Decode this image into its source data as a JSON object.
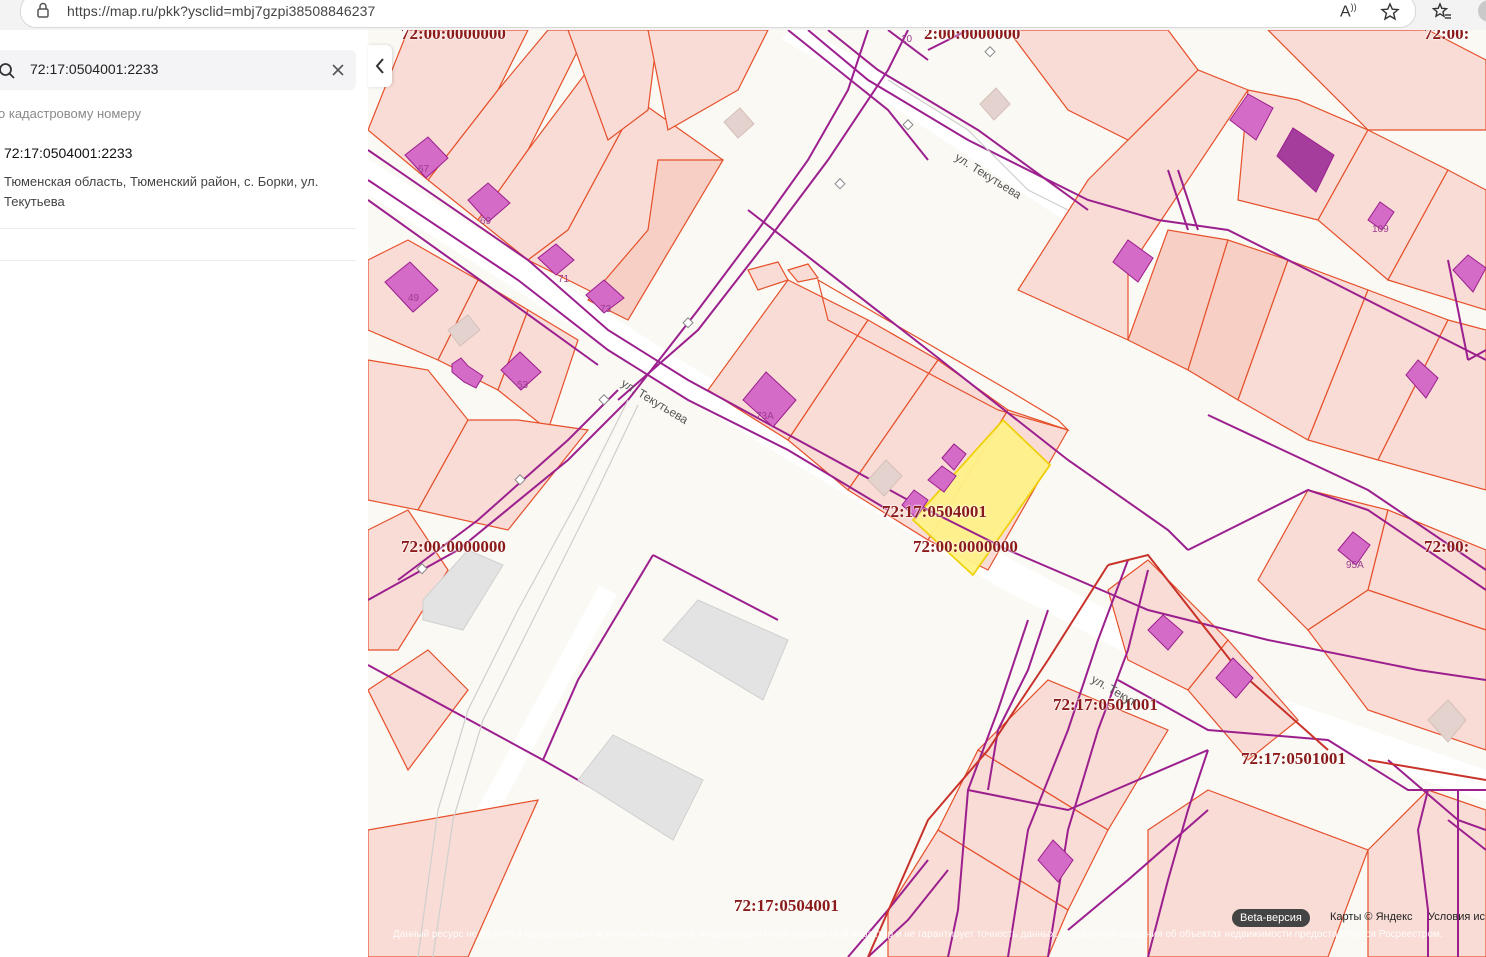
{
  "browser": {
    "url": "https://map.ru/pkk?ysclid=mbj7gzpi38508846237"
  },
  "search": {
    "value": "72:17:0504001:2233",
    "subtitle": "о кадастровому номеру"
  },
  "result": {
    "title": "72:17:0504001:2233",
    "address": "Тюменская область, Тюменский район, с. Борки, ул. Текутьева"
  },
  "map": {
    "quarter_labels": [
      "72:00:0000000",
      "2:00:0000000",
      "72:00:",
      "72:17:0504001",
      "72:00:0000000",
      "72:00:0000000",
      "72:00:",
      "72:17:0501001",
      "72:17:0501001",
      "72:17:0504001"
    ],
    "street_labels": [
      "ул. Текутьева",
      "ул. Текутьева",
      "ул. Текут"
    ],
    "house_numbers": [
      "67",
      "69",
      "71",
      "73",
      "49",
      "53",
      "73А",
      "10",
      "109",
      "95А"
    ],
    "beta_label": "Beta-версия",
    "copyright": "Карты © Яндекс",
    "terms": "Условия ис",
    "disclaimer": "Данный ресурс не является официальным источником сведений. Информация носит справочный характер и не гарантирует точность данных. Актуальные сведения об объектах недвижимости предоставляются Росреестром.",
    "colors": {
      "parcel_fill": "#f9dcd6",
      "parcel_stroke": "#e6502a",
      "utility_line": "#9c1f8e",
      "building": "#d46bc6",
      "selected_parcel": "#fff38a"
    }
  }
}
